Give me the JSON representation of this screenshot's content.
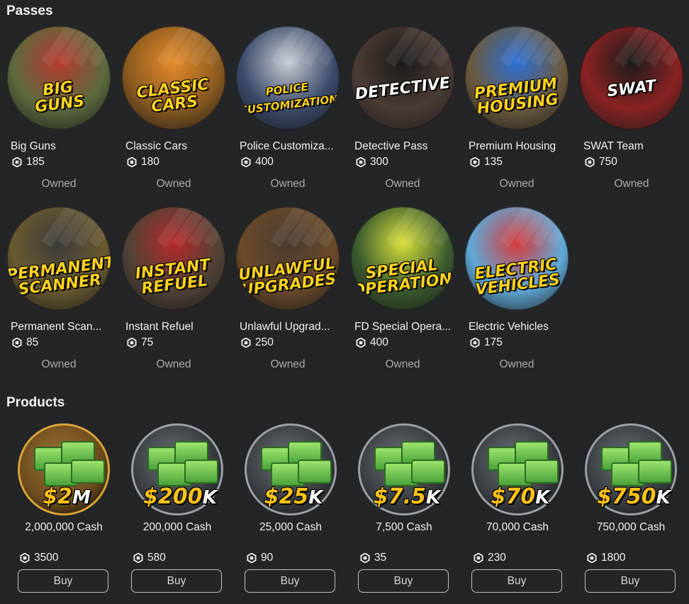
{
  "sections": {
    "passes_title": "Passes",
    "products_title": "Products"
  },
  "passes": [
    {
      "name": "Big Guns",
      "price": "185",
      "status": "Owned",
      "banner": "BIG\nGUNS",
      "bg": "#5b6a3d",
      "accent": "#b83a2e"
    },
    {
      "name": "Classic Cars",
      "price": "180",
      "status": "Owned",
      "banner": "CLASSIC\nCARS",
      "bg": "#8a5a1f",
      "accent": "#e68a2b"
    },
    {
      "name": "Police Customiza...",
      "price": "400",
      "status": "Owned",
      "banner": "POLICE\nCUSTOMIZATION",
      "bg": "#3a4a6a",
      "accent": "#c9ccd4"
    },
    {
      "name": "Detective Pass",
      "price": "300",
      "status": "Owned",
      "banner": "DETECTIVE",
      "bg": "#4a3b34",
      "accent": "#1a1a1a"
    },
    {
      "name": "Premium Housing",
      "price": "135",
      "status": "Owned",
      "banner": "PREMIUM\nHOUSING",
      "bg": "#6b5a3e",
      "accent": "#2b6fd6"
    },
    {
      "name": "SWAT Team",
      "price": "750",
      "status": "Owned",
      "banner": "SWAT",
      "bg": "#8a2222",
      "accent": "#1b1b1b"
    },
    {
      "name": "Permanent Scan...",
      "price": "85",
      "status": "Owned",
      "banner": "PERMANENT\nSCANNER",
      "bg": "#6a5a30",
      "accent": "#3b3b3b"
    },
    {
      "name": "Instant Refuel",
      "price": "75",
      "status": "Owned",
      "banner": "INSTANT\nREFUEL",
      "bg": "#4e4236",
      "accent": "#b52a2a"
    },
    {
      "name": "Unlawful Upgrad...",
      "price": "250",
      "status": "Owned",
      "banner": "UNLAWFUL\nUPGRADES",
      "bg": "#6a4a2a",
      "accent": "#4a3a30"
    },
    {
      "name": "FD Special Opera...",
      "price": "400",
      "status": "Owned",
      "banner": "SPECIAL\nOPERATIONS",
      "bg": "#3a5a2e",
      "accent": "#d8e03a"
    },
    {
      "name": "Electric Vehicles",
      "price": "175",
      "status": "Owned",
      "banner": "ELECTRIC\nVEHICLES",
      "bg": "#5fa9d8",
      "accent": "#d63a3a"
    }
  ],
  "products": [
    {
      "amount": "$2",
      "unit": "M",
      "name": "2,000,000 Cash",
      "price": "3500",
      "button": "Buy",
      "style": "gold"
    },
    {
      "amount": "$200",
      "unit": "K",
      "name": "200,000 Cash",
      "price": "580",
      "button": "Buy",
      "style": "silver"
    },
    {
      "amount": "$25",
      "unit": "K",
      "name": "25,000 Cash",
      "price": "90",
      "button": "Buy",
      "style": "silver"
    },
    {
      "amount": "$7.5",
      "unit": "K",
      "name": "7,500 Cash",
      "price": "35",
      "button": "Buy",
      "style": "silver"
    },
    {
      "amount": "$70",
      "unit": "K",
      "name": "70,000 Cash",
      "price": "230",
      "button": "Buy",
      "style": "silver"
    },
    {
      "amount": "$750",
      "unit": "K",
      "name": "750,000 Cash",
      "price": "1800",
      "button": "Buy",
      "style": "silver"
    }
  ],
  "icons": {
    "currency": "robux-icon"
  },
  "colors": {
    "background": "#232527",
    "text": "#f0f1f2",
    "muted": "#a8aaac",
    "banner_yellow": "#ffd21f"
  }
}
